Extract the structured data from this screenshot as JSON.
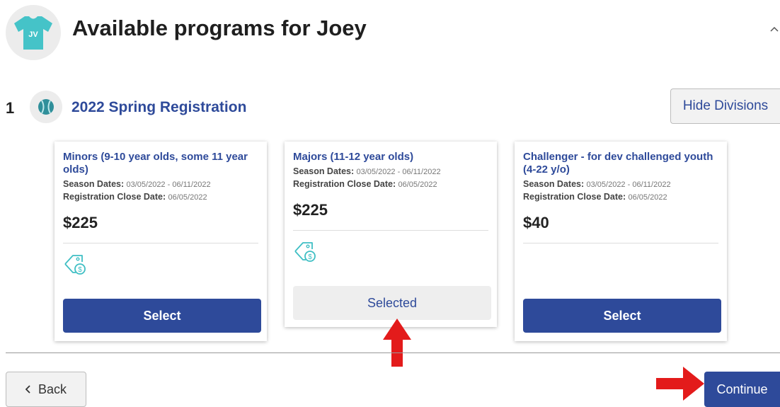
{
  "header": {
    "avatar_initials": "JV",
    "title": "Available programs for Joey",
    "collapse_icon": "chevron-up-icon"
  },
  "season": {
    "step_number": "1",
    "title": "2022 Spring Registration",
    "icon": "baseball-icon",
    "hide_divisions_label": "Hide Divisions"
  },
  "programs": [
    {
      "title": "Minors (9-10 year olds, some 11 year olds)",
      "season_dates_label": "Season Dates:",
      "season_dates": "03/05/2022 - 06/11/2022",
      "close_date_label": "Registration Close Date:",
      "close_date": "06/05/2022",
      "price": "$225",
      "has_discount_tag": true,
      "button_label": "Select",
      "selected": false
    },
    {
      "title": "Majors (11-12 year olds)",
      "season_dates_label": "Season Dates:",
      "season_dates": "03/05/2022 - 06/11/2022",
      "close_date_label": "Registration Close Date:",
      "close_date": "06/05/2022",
      "price": "$225",
      "has_discount_tag": true,
      "button_label": "Selected",
      "selected": true
    },
    {
      "title": "Challenger - for dev challenged youth (4-22 y/o)",
      "season_dates_label": "Season Dates:",
      "season_dates": "03/05/2022 - 06/11/2022",
      "close_date_label": "Registration Close Date:",
      "close_date": "06/05/2022",
      "price": "$40",
      "has_discount_tag": false,
      "button_label": "Select",
      "selected": false
    }
  ],
  "footer": {
    "back_label": "Back",
    "continue_label": "Continue"
  },
  "colors": {
    "primary": "#2e4a9a",
    "accent_teal": "#3fbfc4",
    "annotation_red": "#e31b1b"
  }
}
